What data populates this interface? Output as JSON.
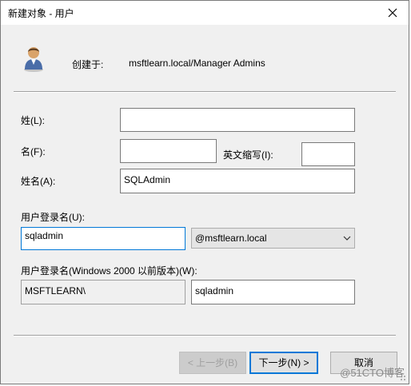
{
  "window": {
    "title": "新建对象 - 用户",
    "close_icon": "close-icon"
  },
  "header": {
    "icon": "user-icon",
    "created_in_label": "创建于:",
    "created_in_value": "msftlearn.local/Manager Admins"
  },
  "form": {
    "last_name": {
      "label": "姓(L):",
      "value": ""
    },
    "first_name": {
      "label": "名(F):",
      "value": ""
    },
    "initials": {
      "label": "英文缩写(I):",
      "value": ""
    },
    "full_name": {
      "label": "姓名(A):",
      "value": "SQLAdmin"
    },
    "logon_name": {
      "label": "用户登录名(U):",
      "value": "sqladmin"
    },
    "upn_suffix": {
      "selected": "@msftlearn.local",
      "chevron_icon": "chevron-down-icon"
    },
    "pre2000": {
      "label": "用户登录名(Windows 2000 以前版本)(W):",
      "domain_value": "MSFTLEARN\\",
      "name_value": "sqladmin"
    }
  },
  "buttons": {
    "back": "< 上一步(B)",
    "next": "下一步(N) >",
    "cancel": "取消"
  },
  "watermark": "@51CTO博客",
  "colors": {
    "focus": "#0078d7",
    "dialog_bg": "#f0f0f0"
  }
}
